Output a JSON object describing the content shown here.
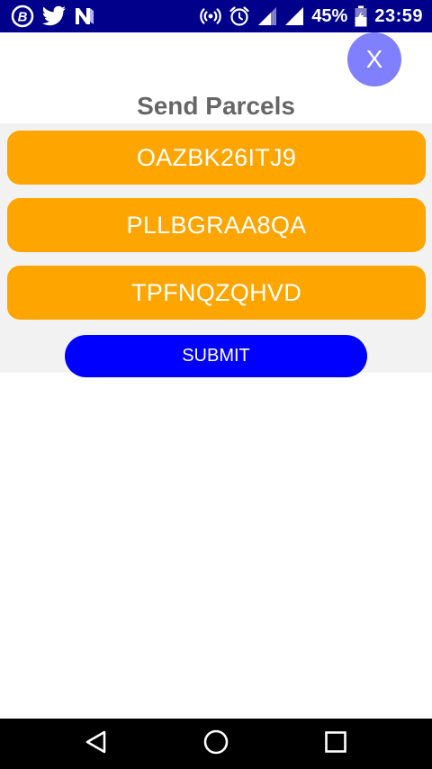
{
  "status_bar": {
    "battery_percent": "45%",
    "time": "23:59",
    "left_icons": [
      "bitcoin-icon",
      "twitter-icon",
      "n-app-icon"
    ],
    "right_icons": [
      "hotspot-icon",
      "alarm-icon",
      "signal-icon",
      "signal-icon",
      "battery-icon"
    ]
  },
  "header": {
    "close_label": "X",
    "title": "Send Parcels"
  },
  "parcels": [
    {
      "code": "OAZBK26ITJ9"
    },
    {
      "code": "PLLBGRAA8QA"
    },
    {
      "code": "TPFNQZQHVD"
    }
  ],
  "submit_label": "SUBMIT",
  "colors": {
    "status_bar": "#00008b",
    "close_button": "#8080ff",
    "title_text": "#666666",
    "panel_background": "#f2f2f2",
    "parcel_button": "#ffa500",
    "submit_button": "#0000ff",
    "nav_bar": "#000000"
  },
  "nav_bar": {
    "icons": [
      "back-icon",
      "home-icon",
      "recents-icon"
    ]
  }
}
